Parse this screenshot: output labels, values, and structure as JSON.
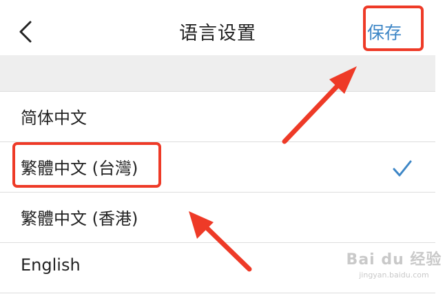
{
  "header": {
    "title": "语言设置",
    "save_label": "保存"
  },
  "icons": {
    "back": "chevron-left-icon",
    "selected": "checkmark-icon"
  },
  "languages": [
    {
      "label": "简体中文",
      "selected": false
    },
    {
      "label": "繁體中文 (台灣)",
      "selected": true
    },
    {
      "label": "繁體中文 (香港)",
      "selected": false
    },
    {
      "label": "English",
      "selected": false
    }
  ],
  "annotations": {
    "highlight_color": "#ee3a27",
    "highlighted_items": [
      "save-button",
      "language-option-traditional-taiwan"
    ]
  },
  "watermark": {
    "brand": "Bai du 经验",
    "domain": "jingyan.baidu.com"
  },
  "colors": {
    "accent": "#3d86c6",
    "annotation": "#ee3a27"
  }
}
